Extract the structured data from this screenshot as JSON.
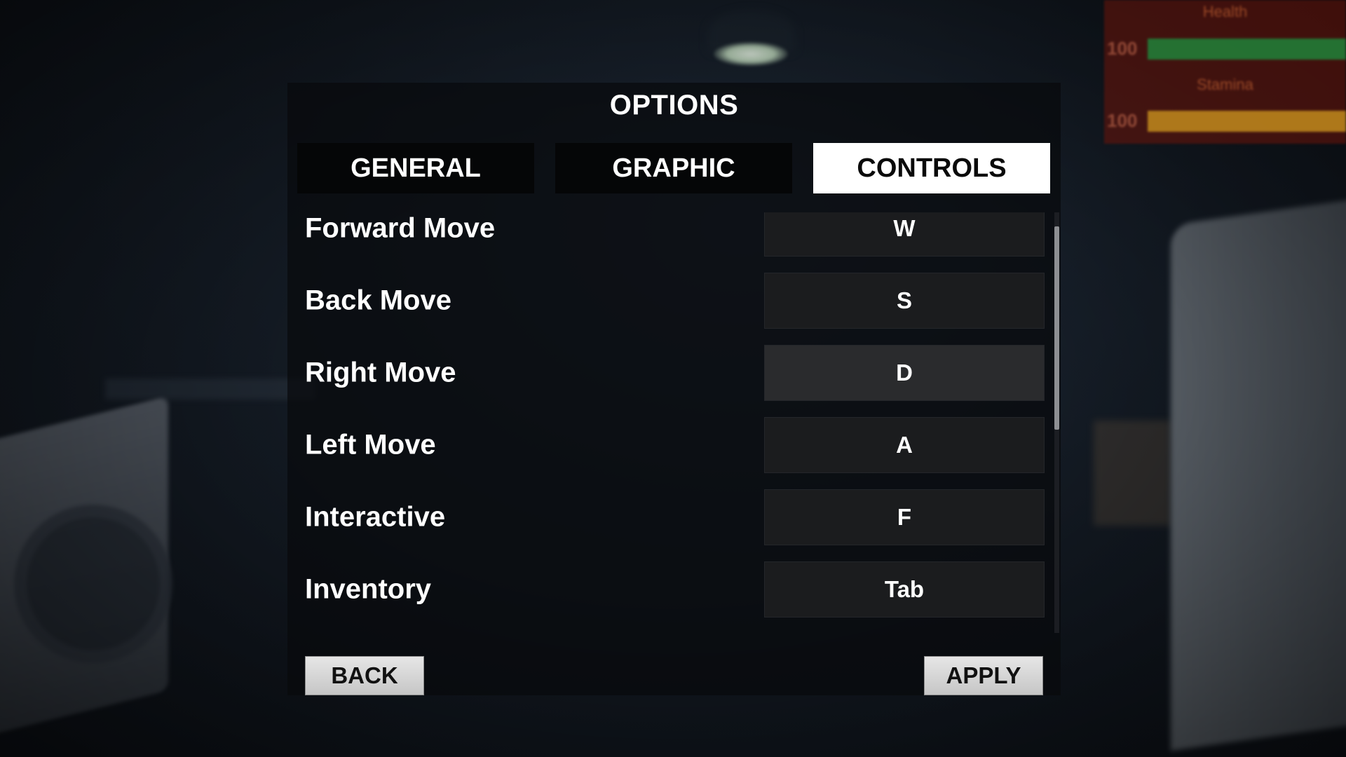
{
  "hud": {
    "health_label": "Health",
    "health_value": "100",
    "health_color": "#1e8a3c",
    "stamina_label": "Stamina",
    "stamina_value": "100",
    "stamina_color": "#c9921e"
  },
  "options": {
    "title": "OPTIONS",
    "tabs": [
      {
        "label": "GENERAL",
        "active": false
      },
      {
        "label": "GRAPHIC",
        "active": false
      },
      {
        "label": "CONTROLS",
        "active": true
      }
    ],
    "controls": [
      {
        "action": "Forward Move",
        "key": "W"
      },
      {
        "action": "Back Move",
        "key": "S"
      },
      {
        "action": "Right Move",
        "key": "D"
      },
      {
        "action": "Left Move",
        "key": "A"
      },
      {
        "action": "Interactive",
        "key": "F"
      },
      {
        "action": "Inventory",
        "key": "Tab"
      }
    ],
    "back_label": "BACK",
    "apply_label": "APPLY"
  }
}
